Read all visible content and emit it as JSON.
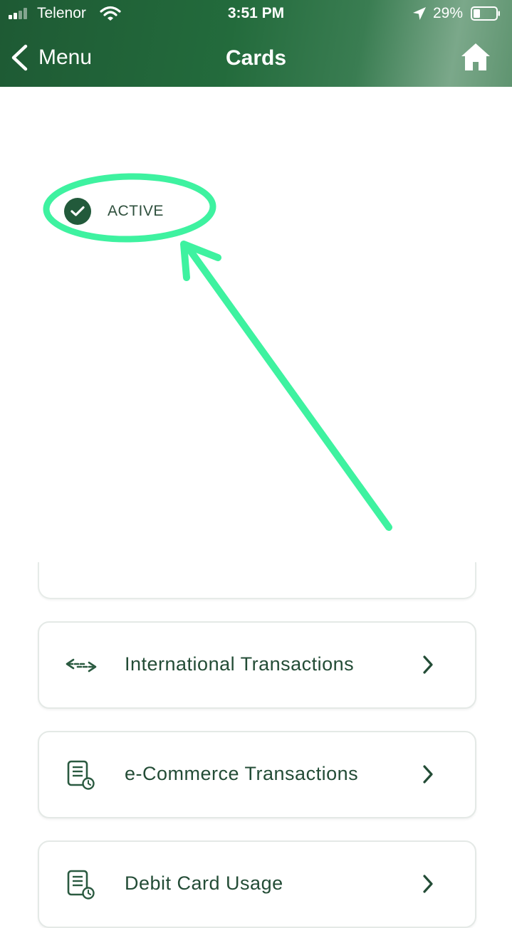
{
  "status_bar": {
    "carrier": "Telenor",
    "time": "3:51 PM",
    "battery_percent": "29%",
    "signal_icon": "cellular-signal-icon",
    "wifi_icon": "wifi-icon",
    "location_icon": "location-arrow-icon",
    "battery_icon": "battery-icon"
  },
  "nav": {
    "back_label": "Menu",
    "title": "Cards",
    "back_icon": "chevron-left-icon",
    "home_icon": "home-icon"
  },
  "card_status": {
    "label": "ACTIVE",
    "icon": "check-circle-icon",
    "annotation": "green hand-drawn ellipse and arrow highlighting status"
  },
  "options": [
    {
      "label": "International Transactions",
      "icon": "transfer-arrows-icon"
    },
    {
      "label": "e-Commerce Transactions",
      "icon": "document-clock-icon"
    },
    {
      "label": "Debit Card Usage",
      "icon": "document-clock-icon"
    }
  ],
  "colors": {
    "brand_green": "#236b3c",
    "text_green": "#234c36",
    "annotation_green": "#3ef2a0",
    "card_border": "#e4e9e6"
  }
}
